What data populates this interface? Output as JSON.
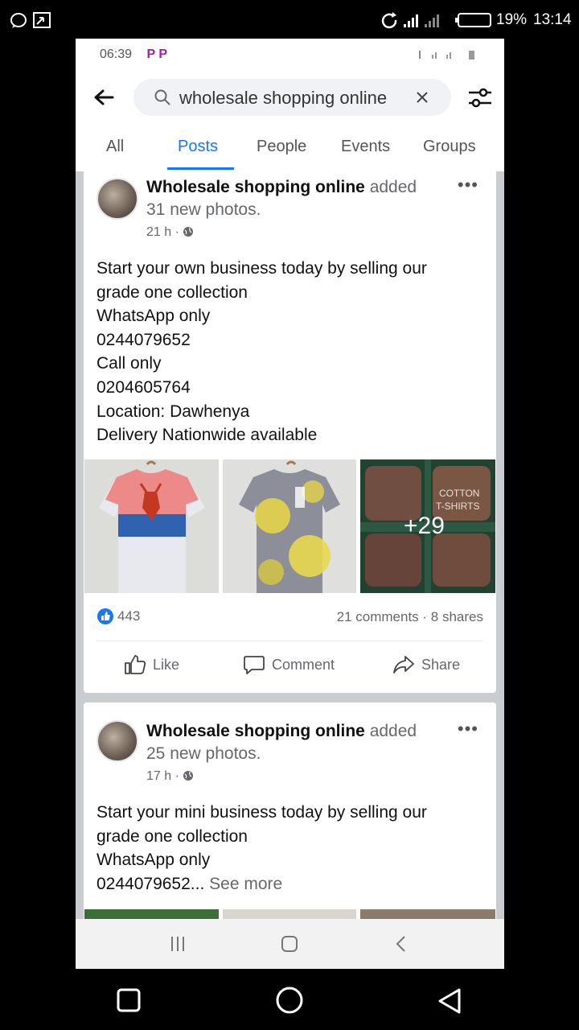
{
  "outer_status": {
    "battery": "19%",
    "time": "13:14"
  },
  "inner_status": {
    "time": "06:39",
    "icons": "P P"
  },
  "search": {
    "query": "wholesale shopping online"
  },
  "tabs": [
    "All",
    "Posts",
    "People",
    "Events",
    "Groups"
  ],
  "active_tab": "Posts",
  "posts": [
    {
      "author": "Wholesale shopping online",
      "action": "added",
      "photos_text": "31 new photos.",
      "time": "21 h ·",
      "body_lines": [
        "Start your own business today by selling our",
        "grade one collection",
        "WhatsApp only",
        "0244079652",
        "Call only",
        "0204605764",
        "Location: Dawhenya",
        "Delivery Nationwide available"
      ],
      "more_photos": "+29",
      "reactions": "443",
      "comments_shares": "21 comments · 8 shares",
      "actions": {
        "like": "Like",
        "comment": "Comment",
        "share": "Share"
      }
    },
    {
      "author": "Wholesale shopping online",
      "action": "added",
      "photos_text": "25 new photos.",
      "time": "17 h ·",
      "body_lines": [
        "Start your mini business today by selling our",
        "grade one collection",
        "WhatsApp only"
      ],
      "last_line": "0244079652...",
      "see_more": "See more"
    }
  ],
  "bale_label": "COTTON T-SHIRTS",
  "colors": {
    "accent": "#1877f2",
    "text": "#111111",
    "secondary": "#65676b"
  }
}
